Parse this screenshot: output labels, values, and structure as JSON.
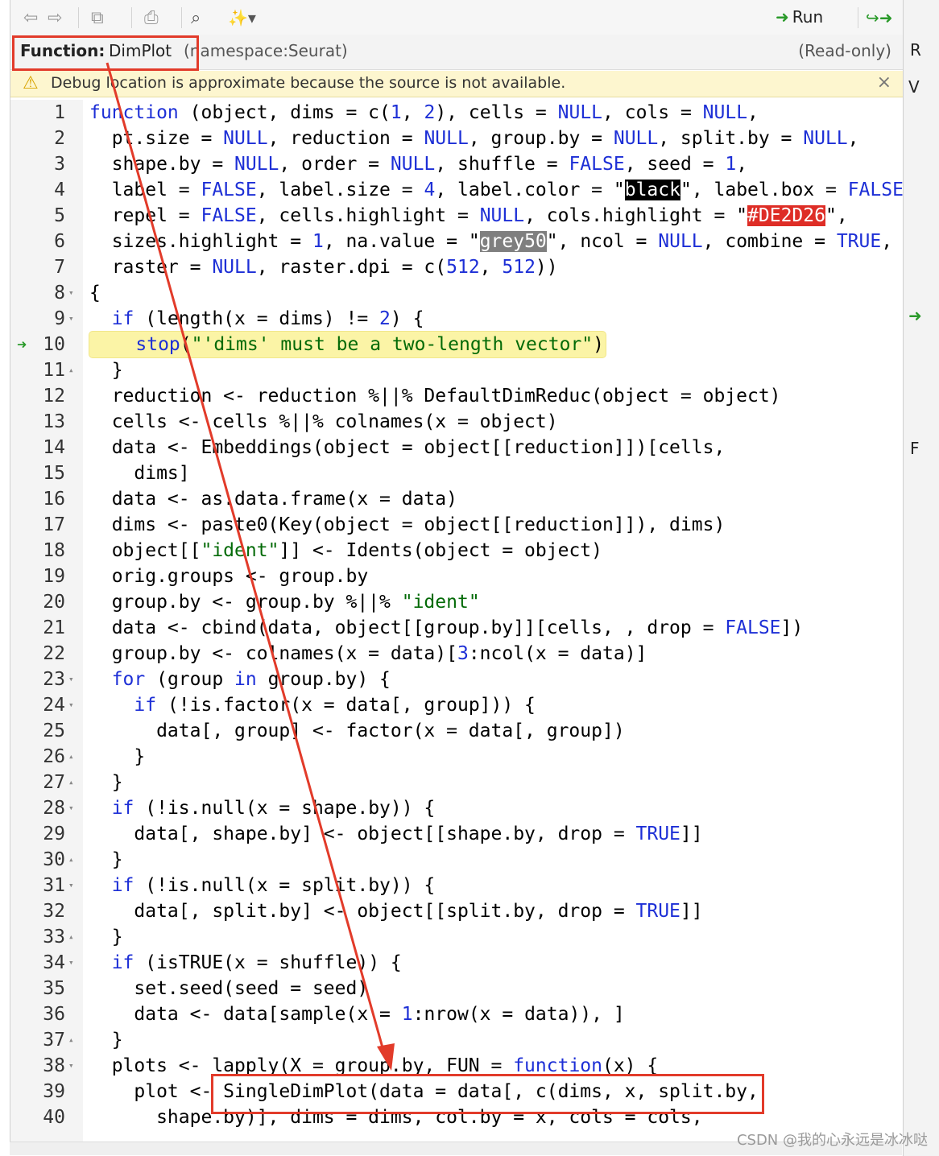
{
  "toolbar": {
    "back_icon": "back-arrow-icon",
    "forward_icon": "forward-arrow-icon",
    "show_in_window_icon": "show-in-window-icon",
    "print_icon": "print-icon",
    "search_icon": "search-icon",
    "magic_wand_icon": "magic-wand-icon",
    "run_label": "Run",
    "run_icon": "run-arrow-icon",
    "rerun_icon": "rerun-icon"
  },
  "info": {
    "label": "Function:",
    "name": "DimPlot",
    "namespace": "(namespace:Seurat)",
    "readonly": "(Read-only)"
  },
  "warning": {
    "icon": "warning-icon",
    "text": "Debug location is approximate because the source is not available.",
    "close": "×"
  },
  "code_lines": [
    {
      "n": "1",
      "fold": ""
    },
    {
      "n": "2",
      "fold": ""
    },
    {
      "n": "3",
      "fold": ""
    },
    {
      "n": "4",
      "fold": ""
    },
    {
      "n": "5",
      "fold": ""
    },
    {
      "n": "6",
      "fold": ""
    },
    {
      "n": "7",
      "fold": ""
    },
    {
      "n": "8",
      "fold": "▾"
    },
    {
      "n": "9",
      "fold": "▾"
    },
    {
      "n": "10",
      "fold": ""
    },
    {
      "n": "11",
      "fold": "▴"
    },
    {
      "n": "12",
      "fold": ""
    },
    {
      "n": "13",
      "fold": ""
    },
    {
      "n": "14",
      "fold": ""
    },
    {
      "n": "15",
      "fold": ""
    },
    {
      "n": "16",
      "fold": ""
    },
    {
      "n": "17",
      "fold": ""
    },
    {
      "n": "18",
      "fold": ""
    },
    {
      "n": "19",
      "fold": ""
    },
    {
      "n": "20",
      "fold": ""
    },
    {
      "n": "21",
      "fold": ""
    },
    {
      "n": "22",
      "fold": ""
    },
    {
      "n": "23",
      "fold": "▾"
    },
    {
      "n": "24",
      "fold": "▾"
    },
    {
      "n": "25",
      "fold": ""
    },
    {
      "n": "26",
      "fold": "▴"
    },
    {
      "n": "27",
      "fold": "▴"
    },
    {
      "n": "28",
      "fold": "▾"
    },
    {
      "n": "29",
      "fold": ""
    },
    {
      "n": "30",
      "fold": "▴"
    },
    {
      "n": "31",
      "fold": "▾"
    },
    {
      "n": "32",
      "fold": ""
    },
    {
      "n": "33",
      "fold": "▴"
    },
    {
      "n": "34",
      "fold": "▾"
    },
    {
      "n": "35",
      "fold": ""
    },
    {
      "n": "36",
      "fold": ""
    },
    {
      "n": "37",
      "fold": "▴"
    },
    {
      "n": "38",
      "fold": "▾"
    },
    {
      "n": "39",
      "fold": ""
    },
    {
      "n": "40",
      "fold": ""
    }
  ],
  "code_text": {
    "l1": [
      "function",
      " (object, dims = c(",
      "1",
      ", ",
      "2",
      "), cells = ",
      "NULL",
      ", cols = ",
      "NULL",
      ","
    ],
    "l2": [
      "  pt.size = ",
      "NULL",
      ", reduction = ",
      "NULL",
      ", group.by = ",
      "NULL",
      ", split.by = ",
      "NULL",
      ","
    ],
    "l3": [
      "  shape.by = ",
      "NULL",
      ", order = ",
      "NULL",
      ", shuffle = ",
      "FALSE",
      ", seed = ",
      "1",
      ","
    ],
    "l4": [
      "  label = ",
      "FALSE",
      ", label.size = ",
      "4",
      ", label.color = \"",
      "black",
      "\", label.box = ",
      "FALSE",
      ","
    ],
    "l5": [
      "  repel = ",
      "FALSE",
      ", cells.highlight = ",
      "NULL",
      ", cols.highlight = \"",
      "#DE2D26",
      "\","
    ],
    "l6": [
      "  sizes.highlight = ",
      "1",
      ", na.value = \"",
      "grey50",
      "\", ncol = ",
      "NULL",
      ", combine = ",
      "TRUE",
      ","
    ],
    "l7": [
      "  raster = ",
      "NULL",
      ", raster.dpi = c(",
      "512",
      ", ",
      "512",
      "))"
    ],
    "l8": "{",
    "l9": [
      "  ",
      "if",
      " (length(x = dims) != ",
      "2",
      ") {"
    ],
    "l10": [
      "    ",
      "stop",
      "(",
      "\"'dims' must be a two-length vector\"",
      ")"
    ],
    "l11": "  }",
    "l12": "  reduction <- reduction %||% DefaultDimReduc(object = object)",
    "l13": "  cells <- cells %||% colnames(x = object)",
    "l14": "  data <- Embeddings(object = object[[reduction]])[cells,",
    "l15": "    dims]",
    "l16": "  data <- as.data.frame(x = data)",
    "l17": "  dims <- paste0(Key(object = object[[reduction]]), dims)",
    "l18": [
      "  object[[",
      "\"ident\"",
      "]] <- Idents(object = object)"
    ],
    "l19": "  orig.groups <- group.by",
    "l20": [
      "  group.by <- group.by %||% ",
      "\"ident\""
    ],
    "l21": [
      "  data <- cbind(data, object[[group.by]][cells, , drop = ",
      "FALSE",
      "])"
    ],
    "l22": [
      "  group.by <- colnames(x = data)[",
      "3",
      ":ncol(x = data)]"
    ],
    "l23": [
      "  ",
      "for",
      " (group ",
      "in",
      " group.by) {"
    ],
    "l24": [
      "    ",
      "if",
      " (!is.factor(x = data[, group])) {"
    ],
    "l25": "      data[, group] <- factor(x = data[, group])",
    "l26": "    }",
    "l27": "  }",
    "l28": [
      "  ",
      "if",
      " (!is.null(x = shape.by)) {"
    ],
    "l29": [
      "    data[, shape.by] <- object[[shape.by, drop = ",
      "TRUE",
      "]]"
    ],
    "l30": "  }",
    "l31": [
      "  ",
      "if",
      " (!is.null(x = split.by)) {"
    ],
    "l32": [
      "    data[, split.by] <- object[[split.by, drop = ",
      "TRUE",
      "]]"
    ],
    "l33": "  }",
    "l34": [
      "  ",
      "if",
      " (isTRUE(x = shuffle)) {"
    ],
    "l35": "    set.seed(seed = seed)",
    "l36": [
      "    data <- data[sample(x = ",
      "1",
      ":nrow(x = data)), ]"
    ],
    "l37": "  }",
    "l38": [
      "  plots <- lapply(X = group.by, FUN = ",
      "function",
      "(x) {"
    ],
    "l39": "    plot <- SingleDimPlot(data = data[, c(dims, x, split.by,",
    "l40": "      shape.by)], dims = dims, col.by = x, cols = cols,"
  },
  "execution_line": "10",
  "execution_icon": "execution-arrow-icon",
  "right_pane": {
    "r": "R",
    "v": "V",
    "f": "F"
  },
  "watermark": "CSDN @我的心永远是冰冰哒",
  "colors": {
    "keyword": "#1d2fd6",
    "annotation_red": "#e23b2a",
    "highlight_line": "#fbf4a6",
    "exec_arrow": "#2a9a2a"
  }
}
